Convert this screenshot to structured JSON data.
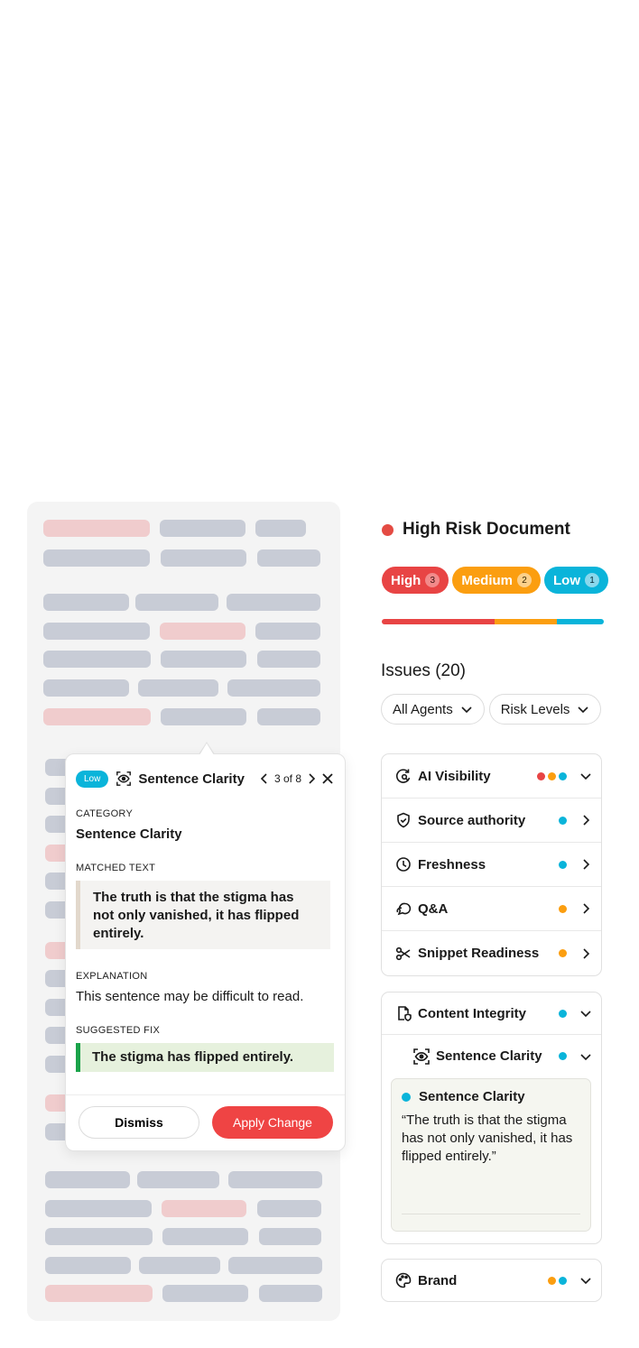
{
  "popover": {
    "severity": "Low",
    "title": "Sentence Clarity",
    "position": "3 of 8",
    "category_label": "CATEGORY",
    "category_value": "Sentence Clarity",
    "matched_label": "MATCHED TEXT",
    "matched_text": "The truth is that the stigma has not only vanished, it has flipped entirely.",
    "explanation_label": "EXPLANATION",
    "explanation_text": "This sentence may be difficult to read.",
    "fix_label": "SUGGESTED FIX",
    "fix_text": "The stigma has flipped entirely.",
    "dismiss_label": "Dismiss",
    "apply_label": "Apply Change"
  },
  "risk": {
    "title": "High Risk Document",
    "high_label": "High",
    "high_count": "3",
    "medium_label": "Medium",
    "medium_count": "2",
    "low_label": "Low",
    "low_count": "1",
    "bar_fractions": {
      "high": 0.51,
      "medium": 0.28,
      "low": 0.21
    }
  },
  "issues": {
    "title": "Issues (20)",
    "filter_agents": "All Agents",
    "filter_risk": "Risk Levels"
  },
  "ai_visibility": {
    "title": "AI Visibility",
    "items": [
      {
        "label": "Source authority"
      },
      {
        "label": "Freshness"
      },
      {
        "label": "Q&A"
      },
      {
        "label": "Snippet Readiness"
      }
    ]
  },
  "content_integrity": {
    "title": "Content Integrity",
    "sub_title": "Sentence Clarity",
    "detail_title": "Sentence Clarity",
    "detail_quote": "“The truth is that the stigma has not only vanished, it has flipped entirely.”"
  },
  "brand": {
    "title": "Brand"
  },
  "colors": {
    "high": "#e84444",
    "medium": "#fb9e10",
    "low": "#0ab4da",
    "fix_accent": "#1aa34a"
  }
}
